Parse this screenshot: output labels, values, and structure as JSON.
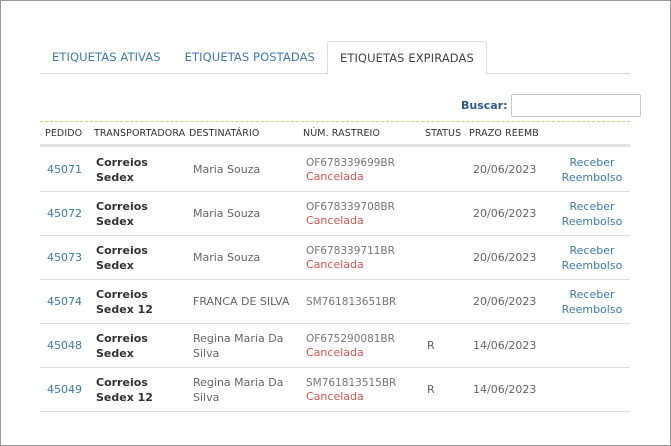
{
  "tabs": [
    {
      "label": "ETIQUETAS ATIVAS"
    },
    {
      "label": "ETIQUETAS POSTADAS"
    },
    {
      "label": "ETIQUETAS EXPIRADAS"
    }
  ],
  "search": {
    "label": "Buscar:",
    "value": ""
  },
  "table": {
    "headers": [
      "PEDIDO",
      "TRANSPORTADORA",
      "DESTINATÁRIO",
      "NÚM. RASTREIO",
      "STATUS",
      "PRAZO REEMB",
      ""
    ],
    "rows": [
      {
        "pedido": "45071",
        "carrier": "Correios Sedex",
        "dest": "Maria Souza",
        "tracking": "OF678339699BR",
        "tracking_status": "Cancelada",
        "status": "",
        "prazo": "20/06/2023",
        "action1": "Receber",
        "action2": "Reembolso"
      },
      {
        "pedido": "45072",
        "carrier": "Correios Sedex",
        "dest": "Maria Souza",
        "tracking": "OF678339708BR",
        "tracking_status": "Cancelada",
        "status": "",
        "prazo": "20/06/2023",
        "action1": "Receber",
        "action2": "Reembolso"
      },
      {
        "pedido": "45073",
        "carrier": "Correios Sedex",
        "dest": "Maria Souza",
        "tracking": "OF678339711BR",
        "tracking_status": "Cancelada",
        "status": "",
        "prazo": "20/06/2023",
        "action1": "Receber",
        "action2": "Reembolso"
      },
      {
        "pedido": "45074",
        "carrier": "Correios Sedex 12",
        "dest": "FRANCA DE SILVA",
        "tracking": "SM761813651BR",
        "tracking_status": "",
        "status": "",
        "prazo": "20/06/2023",
        "action1": "Receber",
        "action2": "Reembolso"
      },
      {
        "pedido": "45048",
        "carrier": "Correios Sedex",
        "dest": "Regina Maria Da Silva",
        "tracking": "OF675290081BR",
        "tracking_status": "Cancelada",
        "status": "R",
        "prazo": "14/06/2023",
        "action1": "",
        "action2": ""
      },
      {
        "pedido": "45049",
        "carrier": "Correios Sedex 12",
        "dest": "Regina Maria Da Silva",
        "tracking": "SM761813515BR",
        "tracking_status": "Cancelada",
        "status": "R",
        "prazo": "14/06/2023",
        "action1": "",
        "action2": ""
      }
    ]
  }
}
